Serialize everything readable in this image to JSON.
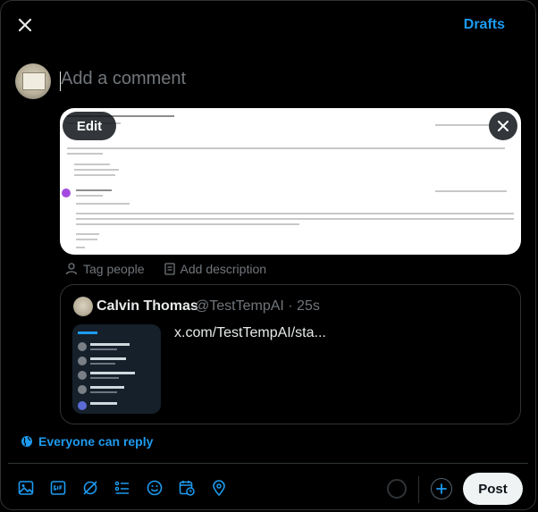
{
  "header": {
    "close_icon": "close-icon",
    "drafts_label": "Drafts"
  },
  "composer": {
    "placeholder": "Add a comment"
  },
  "media": {
    "edit_label": "Edit",
    "remove_icon": "close-icon"
  },
  "media_actions": {
    "tag_people": "Tag people",
    "add_description": "Add description"
  },
  "quoted_post": {
    "name": "Calvin Thomas",
    "handle": "@TestTempAI · 25s",
    "link_text": "x.com/TestTempAI/sta..."
  },
  "reply_setting": {
    "label": "Everyone can reply"
  },
  "toolbar": {
    "icons": [
      "image-icon",
      "gif-icon",
      "grok-icon",
      "poll-icon",
      "emoji-icon",
      "schedule-icon",
      "location-icon"
    ],
    "post_label": "Post"
  },
  "colors": {
    "accent": "#1d9bf0",
    "background": "#000000",
    "muted": "#71767b"
  }
}
